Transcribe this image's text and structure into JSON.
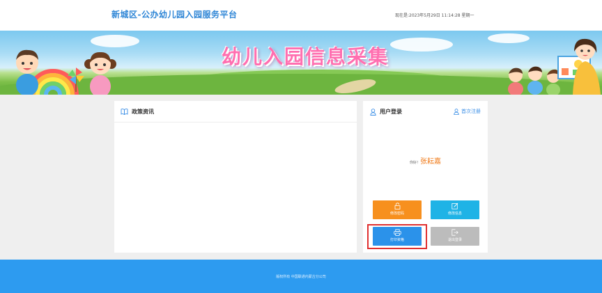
{
  "header": {
    "site_title": "新城区-公办幼儿园入园服务平台",
    "datetime": "现在是:2023年5月29日 11:14:28 星期一"
  },
  "banner": {
    "title": "幼儿入园信息采集"
  },
  "policy": {
    "title": "政策资讯",
    "icon": "book-icon"
  },
  "login": {
    "title": "用户登录",
    "title_icon": "user-icon",
    "register_link": "首次注册",
    "register_icon": "user-outline-icon",
    "greeting": "你好！",
    "user_name": "张耘嘉",
    "buttons": [
      {
        "label": "修改密码",
        "icon": "lock-icon",
        "color": "#f7901e"
      },
      {
        "label": "修改信息",
        "icon": "edit-icon",
        "color": "#1fb3e6"
      },
      {
        "label": "打印资格",
        "icon": "printer-icon",
        "color": "#2b92ea"
      },
      {
        "label": "退出登录",
        "icon": "logout-icon",
        "color": "#bcbcbc"
      }
    ],
    "highlight_color": "#e03030"
  },
  "footer": {
    "copyright": "版权所有 中国联通内蒙古分公司"
  },
  "colors": {
    "brand_blue": "#2f86d6",
    "footer_blue": "#2d9bf0",
    "accent_orange": "#f07c1c"
  }
}
